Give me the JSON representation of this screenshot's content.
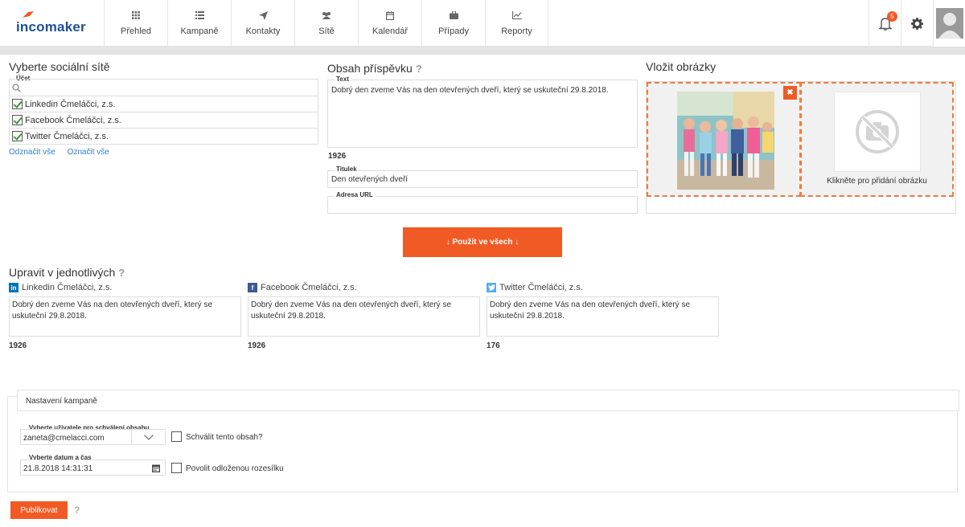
{
  "brand": {
    "logo_text": "incomaker"
  },
  "nav": [
    {
      "label": "Přehled",
      "icon": "grid-icon"
    },
    {
      "label": "Kampaně",
      "icon": "list-icon"
    },
    {
      "label": "Kontakty",
      "icon": "paper-plane-icon"
    },
    {
      "label": "Sítě",
      "icon": "users-icon"
    },
    {
      "label": "Kalendář",
      "icon": "calendar-icon"
    },
    {
      "label": "Případy",
      "icon": "briefcase-icon"
    },
    {
      "label": "Reporty",
      "icon": "line-chart-icon"
    }
  ],
  "topright": {
    "notification_count": "5"
  },
  "social": {
    "title": "Vyberte sociální sítě",
    "account_label": "Účet",
    "accounts": [
      "Linkedin Čmeláčci, z.s.",
      "Facebook Čmeláčci, z.s.",
      "Twitter Čmeláčci, z.s."
    ],
    "unselect_all": "Odznačit vše",
    "select_all": "Označit vše"
  },
  "content": {
    "title": "Obsah příspěvku",
    "text_label": "Text",
    "text_value": "Dobrý den zveme Vás na den otevřených dveří, který se uskuteční 29.8.2018.",
    "text_count": "1926",
    "title_label": "Titulek",
    "title_value": "Den otevřených dveří",
    "url_label": "Adresa URL",
    "url_value": "",
    "apply_button": "↓ Použít ve všech ↓"
  },
  "images": {
    "title": "Vložit obrázky",
    "add_text": "Klikněte pro přidání obrázku"
  },
  "individual": {
    "title": "Upravit v jednotlivých",
    "networks": [
      {
        "name": "Linkedin Čmeláčci, z.s.",
        "icon": "linkedin-icon",
        "color": "#0077b5",
        "text": "Dobrý den zveme Vás na den otevřených dveří, který se uskuteční 29.8.2018.",
        "count": "1926"
      },
      {
        "name": "Facebook Čmeláčci, z.s.",
        "icon": "facebook-icon",
        "color": "#3b5998",
        "text": "Dobrý den zveme Vás na den otevřených dveří, který se uskuteční 29.8.2018.",
        "count": "1926"
      },
      {
        "name": "Twitter Čmeláčci, z.s.",
        "icon": "twitter-icon",
        "color": "#55acee",
        "text": "Dobrý den zveme Vás na den otevřených dveří, který se uskuteční 29.8.2018.",
        "count": "176"
      }
    ]
  },
  "settings": {
    "title": "Nastavení kampaně",
    "approver_label": "Vyberte uživatele pro schválení obsahu",
    "approver_value": "zaneta@cmelacci.com",
    "approve_checkbox": "Schválit tento obsah?",
    "date_label": "Vyberte datum a čas",
    "date_value": "21.8.2018 14:31:31",
    "delay_checkbox": "Povolit odloženou rozesílku"
  },
  "actions": {
    "publish": "Publikovat"
  },
  "colors": {
    "accent": "#f15a24",
    "brand": "#1d4f9c",
    "check": "#3a9a3a"
  }
}
